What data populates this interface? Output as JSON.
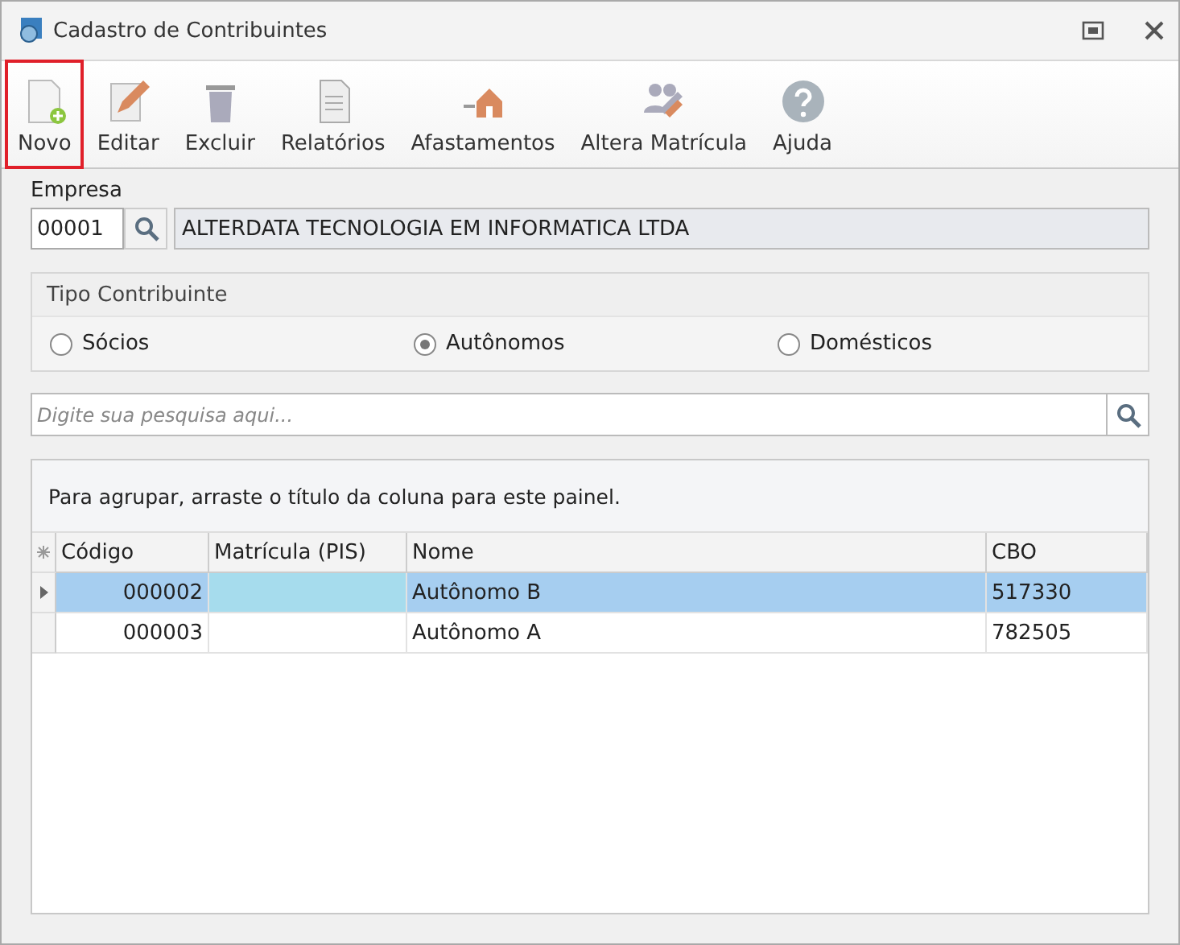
{
  "window": {
    "title": "Cadastro de Contribuintes"
  },
  "toolbar": [
    {
      "label": "Novo",
      "highlighted": true
    },
    {
      "label": "Editar",
      "highlighted": false
    },
    {
      "label": "Excluir",
      "highlighted": false
    },
    {
      "label": "Relatórios",
      "highlighted": false
    },
    {
      "label": "Afastamentos",
      "highlighted": false
    },
    {
      "label": "Altera Matrícula",
      "highlighted": false
    },
    {
      "label": "Ajuda",
      "highlighted": false
    }
  ],
  "empresa": {
    "label": "Empresa",
    "code": "00001",
    "name": "ALTERDATA TECNOLOGIA EM INFORMATICA LTDA"
  },
  "tipo_contribuinte": {
    "title": "Tipo Contribuinte",
    "options": [
      {
        "label": "Sócios",
        "selected": false
      },
      {
        "label": "Autônomos",
        "selected": true
      },
      {
        "label": "Domésticos",
        "selected": false
      }
    ]
  },
  "search": {
    "placeholder": "Digite sua pesquisa aqui..."
  },
  "grid": {
    "group_hint": "Para agrupar, arraste o título da coluna para este painel.",
    "columns": [
      "Código",
      "Matrícula (PIS)",
      "Nome",
      "CBO"
    ],
    "rows": [
      {
        "selected": true,
        "cells": [
          "000002",
          "",
          "Autônomo B",
          "517330"
        ]
      },
      {
        "selected": false,
        "cells": [
          "000003",
          "",
          "Autônomo A",
          "782505"
        ]
      }
    ]
  }
}
